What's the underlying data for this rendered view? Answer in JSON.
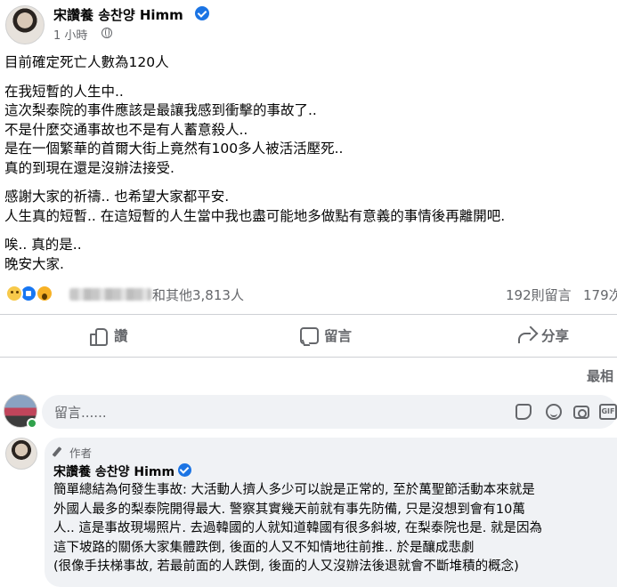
{
  "post": {
    "author": "宋讚養 송찬양 Himm",
    "time": "1 小時",
    "lines": [
      "目前確定死亡人數為120人",
      "在我短暫的人生中..",
      "這次梨泰院的事件應該是最讓我感到衝擊的事故了..",
      "不是什麼交通事故也不是有人蓄意殺人..",
      "是在一個繁華的首爾大街上竟然有100多人被活活壓死..",
      "真的到現在還是沒辦法接受.",
      "感謝大家的祈禱.. 也希望大家都平安.",
      "人生真的短暫.. 在這短暫的人生當中我也盡可能地多做點有意義的事情後再離開吧.",
      "唉.. 真的是..",
      "晚安大家."
    ]
  },
  "reactions": {
    "icons": [
      "sad-icon",
      "like-icon",
      "wow-icon"
    ],
    "text": "和其他3,813人",
    "comments": "192則留言",
    "shares": "179次"
  },
  "actions": {
    "like": "讚",
    "comment": "留言",
    "share": "分享"
  },
  "sort": "最相",
  "composer": {
    "placeholder": "留言......"
  },
  "comment": {
    "badge": "作者",
    "author": "宋讚養 송찬양 Himm",
    "lines": [
      "簡單總結為何發生事故: 大活動人擠人多少可以說是正常的, 至於萬聖節活動本來就是",
      "外國人最多的梨泰院開得最大. 警察其實幾天前就有事先防備, 只是沒想到會有10萬",
      "人.. 這是事故現場照片. 去過韓國的人就知道韓國有很多斜坡, 在梨泰院也是. 就是因為",
      "這下坡路的關係大家集體跌倒, 後面的人又不知情地往前推.. 於是釀成悲劇",
      "(很像手扶梯事故, 若最前面的人跌倒, 後面的人又沒辦法後退就會不斷堆積的概念)"
    ]
  },
  "colors": {
    "link_blue": "#1b74e4",
    "secondary_text": "#65676b",
    "input_bg": "#f0f2f5"
  }
}
